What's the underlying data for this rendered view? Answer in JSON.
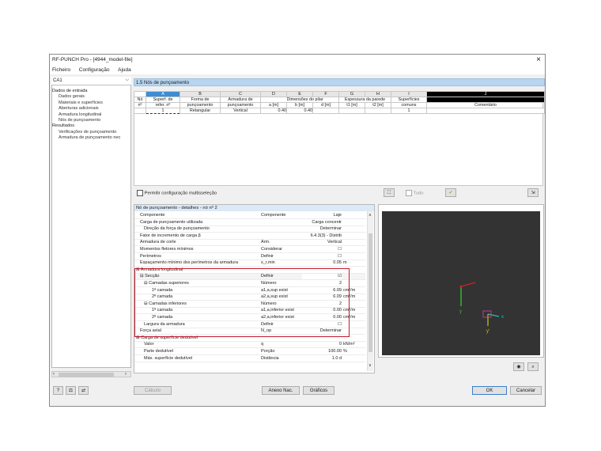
{
  "window": {
    "title": "RF-PUNCH Pro - [4944_model-file]",
    "close": "×"
  },
  "menu": [
    "Ficheiro",
    "Configuração",
    "Ajuda"
  ],
  "case": {
    "value": "CA1",
    "arrow": "⌵"
  },
  "tree": [
    {
      "label": "Dados de entrada",
      "level": 0
    },
    {
      "label": "Dados gerais",
      "level": 1
    },
    {
      "label": "Materiais e superfícies",
      "level": 1
    },
    {
      "label": "Aberturas adicionais",
      "level": 1
    },
    {
      "label": "Armadura longitudinal",
      "level": 1
    },
    {
      "label": "Nós de punçoamento",
      "level": 1
    },
    {
      "label": "Resultados",
      "level": 0
    },
    {
      "label": "Verificações de punçoamento",
      "level": 1
    },
    {
      "label": "Armadura de punçoamento nec",
      "level": 1
    }
  ],
  "panel_title": "1.5 Nós de punçoamento",
  "grid": {
    "letters": [
      "A",
      "B",
      "C",
      "D",
      "E",
      "F",
      "G",
      "H",
      "I",
      "J"
    ],
    "h1": [
      "Nó",
      "Superf. de",
      "Forma de",
      "Armadura de",
      "",
      "Dimensões do pilar",
      "",
      "Espessura da parede",
      "",
      "Superfícies",
      ""
    ],
    "h2": [
      "nº",
      "refer. nº",
      "punçoamento",
      "punçoamento",
      "a [m]",
      "b [m]",
      "d [m]",
      "t1 [m]",
      "t2 [m]",
      "comuns",
      "Comentário"
    ],
    "row": [
      "2",
      "1",
      "Retangular",
      "Vertical",
      "0.40",
      "0.40",
      "",
      "",
      "",
      "1",
      ""
    ]
  },
  "multiselect_label": "Permitir configuração multisseleção",
  "tudo_label": "Tudo",
  "detail": {
    "header": "Nó de punçoamento - detalhes - nó nº 2",
    "rows": [
      {
        "a": "Componente",
        "b": "Componente",
        "c": "Laje",
        "d": "",
        "ind": 1
      },
      {
        "a": "Carga de punçoamento utilizada",
        "b": "",
        "c": "Carga concentr",
        "d": "",
        "ind": 1
      },
      {
        "a": "Direção da força de punçoamento",
        "b": "",
        "c": "Determinar",
        "d": "",
        "ind": 2
      },
      {
        "a": "Fator de incremento de carga β",
        "b": "",
        "c": "6.4.3(3) - Distrib",
        "d": "",
        "ind": 1
      },
      {
        "a": "Armadura de corte",
        "b": "Arm.",
        "c": "Vertical",
        "d": "",
        "ind": 1
      },
      {
        "a": "Momentos fletores mínimos",
        "b": "Considerar",
        "c": "☐",
        "d": "",
        "ind": 1
      },
      {
        "a": "Perímetros",
        "b": "Definir",
        "c": "☐",
        "d": "",
        "ind": 1
      },
      {
        "a": "Espaçamento mínimo dos perímetros da armadura",
        "b": "s_r,min",
        "c": "0.05",
        "d": "m",
        "ind": 1
      },
      {
        "a": "⊟ Armadura longitudinal",
        "b": "",
        "c": "",
        "d": "",
        "ind": 0
      },
      {
        "a": "⊟ Secção",
        "b": "Definir",
        "c": "☑",
        "d": "",
        "ind": 1
      },
      {
        "a": "⊟ Camadas superiores",
        "b": "Número",
        "c": "2",
        "d": "",
        "ind": 2
      },
      {
        "a": "1ª camada",
        "b": "a1,a,sup exist",
        "c": "6.09",
        "d": "cm²/m",
        "ind": 4
      },
      {
        "a": "2ª camada",
        "b": "a2,a,sup exist",
        "c": "6.09",
        "d": "cm²/m",
        "ind": 4
      },
      {
        "a": "⊟ Camadas inferiores",
        "b": "Número",
        "c": "2",
        "d": "",
        "ind": 2
      },
      {
        "a": "1ª camada",
        "b": "a1,a,inferior exist",
        "c": "0.00",
        "d": "cm²/m",
        "ind": 4
      },
      {
        "a": "2ª camada",
        "b": "a2,a,inferior exist",
        "c": "0.00",
        "d": "cm²/m",
        "ind": 4
      },
      {
        "a": "Largura da armadura",
        "b": "Definir",
        "c": "☐",
        "d": "",
        "ind": 2
      },
      {
        "a": "Força axial",
        "b": "N_op",
        "c": "Determinar",
        "d": "",
        "ind": 1
      },
      {
        "a": "⊟ Carga de superfície dedutível",
        "b": "",
        "c": "",
        "d": "",
        "ind": 0
      },
      {
        "a": "Valor",
        "b": "q",
        "c": "0",
        "d": "kN/m²",
        "ind": 2
      },
      {
        "a": "Parte dedutível",
        "b": "Porção",
        "c": "100.00",
        "d": "%",
        "ind": 2
      },
      {
        "a": "Máx. superfície dedutível",
        "b": "Distância",
        "c": "1.0 d",
        "d": "",
        "ind": 2
      }
    ]
  },
  "buttons": {
    "calculo": "Cálculo",
    "anexo": "Anexo Nac.",
    "graficos": "Gráficos",
    "ok": "OK",
    "cancel": "Cancelar"
  },
  "axes": {
    "x": "x",
    "y": "y",
    "yprime": "y'"
  }
}
